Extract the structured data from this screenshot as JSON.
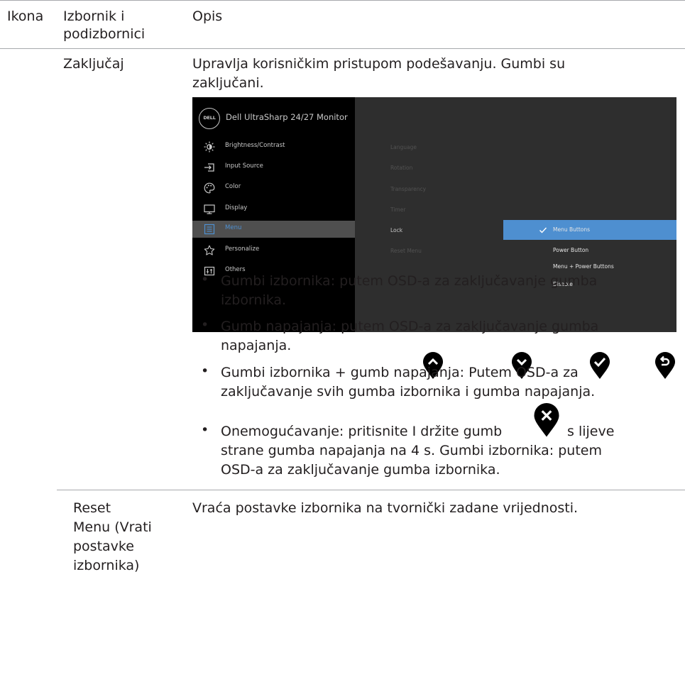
{
  "table": {
    "headers": [
      "Ikona",
      "Izbornik i",
      "podizbornici",
      "Opis"
    ],
    "row1": {
      "menu": "Zaključaj",
      "desc_line1": "Upravlja korisničkim pristupom podešavanju. Gumbi su",
      "desc_line2": "zaključani."
    },
    "row2": {
      "menu_lines": [
        "Reset",
        "Menu (Vrati",
        "postavke",
        "izbornika)"
      ],
      "desc": "Vraća postavke izbornika na tvornički zadane vrijednosti."
    }
  },
  "osd": {
    "logo": "DELL",
    "title": "Dell UltraSharp 24/27 Monitor",
    "menu_items": [
      {
        "label": "Brightness/Contrast",
        "icon": "brightness-icon"
      },
      {
        "label": "Input Source",
        "icon": "input-source-icon"
      },
      {
        "label": "Color",
        "icon": "color-palette-icon"
      },
      {
        "label": "Display",
        "icon": "display-icon"
      },
      {
        "label": "Menu",
        "icon": "menu-icon",
        "selected": true
      },
      {
        "label": "Personalize",
        "icon": "star-icon"
      },
      {
        "label": "Others",
        "icon": "others-icon"
      }
    ],
    "submenu": [
      "Language",
      "Rotation",
      "Transparency",
      "Timer",
      "Lock",
      "Reset Menu"
    ],
    "submenu_active": "Lock",
    "options": [
      "Menu Buttons",
      "Power Button",
      "Menu + Power Buttons",
      "Disable"
    ],
    "option_selected": "Menu Buttons",
    "colors": {
      "left_panel": "#000000",
      "right_panel": "#2e2e2e",
      "selection": "#4e8fd0"
    }
  },
  "buttons": [
    "up-icon",
    "down-icon",
    "check-icon",
    "back-icon"
  ],
  "bullets": {
    "b1": [
      "Gumbi izbornika: putem OSD-a za zaključavanje gumba",
      "izbornika."
    ],
    "b2": [
      "Gumb napajanja: putem OSD-a za zaključavanje gumba",
      "napajanja."
    ],
    "b3": [
      "Gumbi izbornika + gumb napajanja: Putem OSD-a za",
      "zaključavanje svih gumba izbornika i gumba napajanja."
    ],
    "b4_pre": "Onemogućavanje: pritisnite I držite gumb",
    "b4_post": "s lijeve",
    "b4_lines": [
      "strane gumba napajanja na 4 s. Gumbi izbornika: putem",
      "OSD-a za zaključavanje gumba izbornika."
    ]
  }
}
